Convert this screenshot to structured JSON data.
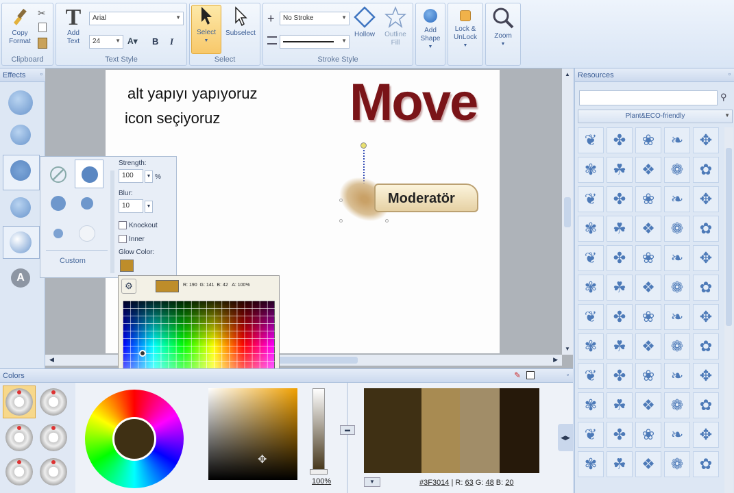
{
  "ribbon": {
    "clipboard": {
      "label": "Clipboard",
      "copy_format": "Copy Format"
    },
    "text_style": {
      "label": "Text Style",
      "add_text": "Add Text",
      "font": "Arial",
      "size": "24",
      "bold": "B",
      "italic": "I",
      "align": "A"
    },
    "select_group": {
      "label": "Select",
      "select": "Select",
      "subselect": "Subselect"
    },
    "stroke_style": {
      "label": "Stroke Style",
      "stroke": "No Stroke",
      "hollow": "Hollow",
      "outline_fill": "Outline Fill"
    },
    "add_shape": "Add Shape",
    "lock": "Lock & UnLock",
    "zoom": "Zoom"
  },
  "effects": {
    "title": "Effects",
    "letter": "A"
  },
  "canvas": {
    "line1": "alt yapıyı yapıyoruz",
    "line2": "icon seçiyoruz",
    "big_title": "Move",
    "tag_text": "Moderatör"
  },
  "glow": {
    "strength_label": "Strength:",
    "strength_value": "100",
    "strength_unit": "%",
    "blur_label": "Blur:",
    "blur_value": "10",
    "knockout": "Knockout",
    "inner": "Inner",
    "glow_color_label": "Glow Color:",
    "custom": "Custom",
    "glow_color": "#BE8D2A"
  },
  "picker": {
    "readout": "R: 190  G: 141  B: 42   A: 100%"
  },
  "colors": {
    "title": "Colors",
    "opacity": "100",
    "opacity_unit": "%",
    "hex": "#3F3014",
    "r_label": "R:",
    "r": "63",
    "g_label": "G:",
    "g": "48",
    "b_label": "B:",
    "b": "20",
    "swatches": [
      "#3F3014",
      "#A88B52",
      "#A18D68",
      "#26190A"
    ]
  },
  "resources": {
    "title": "Resources",
    "search_placeholder": "",
    "category": "Plant&ECO-friendly",
    "icons": [
      "leaf-icon",
      "feather-icon",
      "maple-icon",
      "fern-icon",
      "oak-icon",
      "clover-icon"
    ]
  }
}
